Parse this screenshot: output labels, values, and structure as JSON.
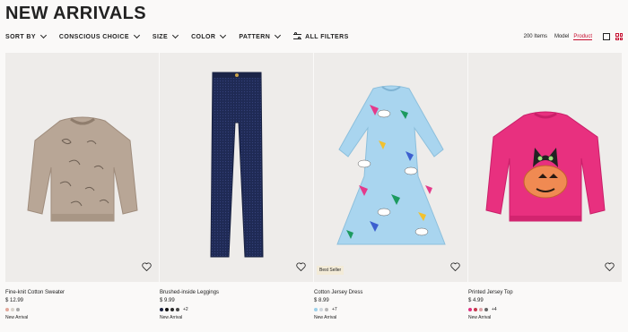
{
  "page": {
    "title": "NEW ARRIVALS"
  },
  "filters": {
    "sort_by": "SORT BY",
    "conscious_choice": "CONSCIOUS CHOICE",
    "size": "SIZE",
    "color": "COLOR",
    "pattern": "PATTERN",
    "all_filters": "ALL FILTERS"
  },
  "toolbar": {
    "items_count": "200 Items",
    "model_label": "Model",
    "product_label": "Product",
    "active_color": "#c60e2f"
  },
  "products": [
    {
      "name": "Fine-knit Cotton Sweater",
      "price": "$ 12.99",
      "more": "",
      "tag": "New Arrival",
      "badge": "",
      "swatches": [
        "#e2a79a",
        "#d8d2cb",
        "#a7a7a7"
      ],
      "image": "beige-cat-sweater"
    },
    {
      "name": "Brushed-inside Leggings",
      "price": "$ 9.99",
      "more": "+2",
      "tag": "New Arrival",
      "badge": "",
      "swatches": [
        "#1b2240",
        "#111111",
        "#2b2b2b",
        "#444444"
      ],
      "image": "navy-leggings"
    },
    {
      "name": "Cotton Jersey Dress",
      "price": "$ 8.99",
      "more": "+7",
      "tag": "New Arrival",
      "badge": "Best Seller",
      "swatches": [
        "#9bd0ea",
        "#cfd6dc",
        "#b7b7b7"
      ],
      "image": "blue-unicorn-dress"
    },
    {
      "name": "Printed Jersey Top",
      "price": "$ 4.99",
      "more": "+4",
      "tag": "New Arrival",
      "badge": "",
      "swatches": [
        "#e0307f",
        "#c4374b",
        "#d9a2a6",
        "#666666"
      ],
      "image": "pink-pumpkin-top"
    }
  ]
}
